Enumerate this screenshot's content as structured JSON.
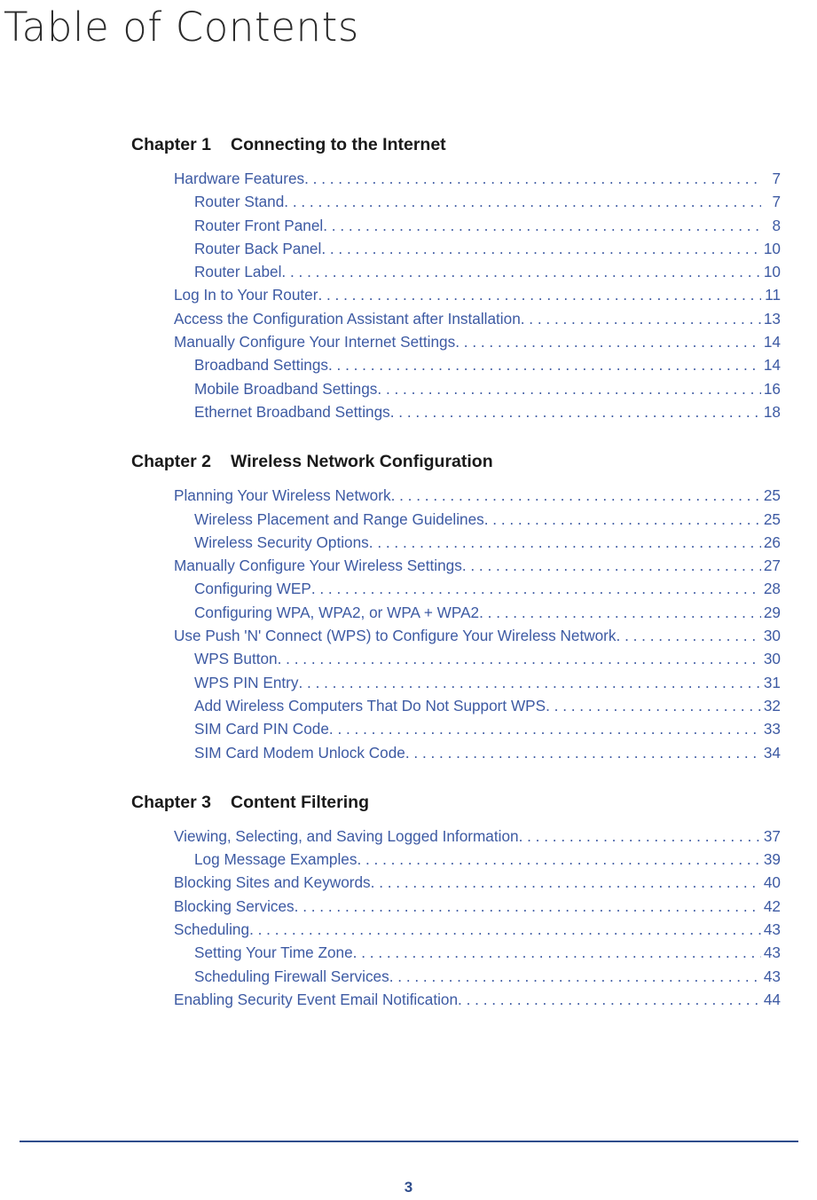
{
  "document": {
    "title": "Table of Contents",
    "page_number": "3",
    "accent_color": "#3d5aa3",
    "rule_color": "#2f4d8c",
    "title_color": "#2b2b2b",
    "heading_color": "#1a1a1a"
  },
  "chapters": [
    {
      "number": "Chapter 1",
      "name": "Connecting to the Internet",
      "entries": [
        {
          "level": 1,
          "title": "Hardware Features",
          "page": "7"
        },
        {
          "level": 2,
          "title": "Router Stand",
          "page": "7"
        },
        {
          "level": 2,
          "title": "Router Front Panel",
          "page": "8"
        },
        {
          "level": 2,
          "title": "Router Back Panel",
          "page": "10"
        },
        {
          "level": 2,
          "title": "Router Label",
          "page": "10"
        },
        {
          "level": 1,
          "title": "Log In to Your Router",
          "page": "11"
        },
        {
          "level": 1,
          "title": "Access the Configuration Assistant after Installation",
          "page": "13"
        },
        {
          "level": 1,
          "title": "Manually Configure Your Internet Settings",
          "page": "14"
        },
        {
          "level": 2,
          "title": "Broadband Settings",
          "page": "14"
        },
        {
          "level": 2,
          "title": "Mobile Broadband Settings",
          "page": "16"
        },
        {
          "level": 2,
          "title": "Ethernet Broadband Settings",
          "page": "18"
        }
      ]
    },
    {
      "number": "Chapter 2",
      "name": "Wireless Network Configuration",
      "entries": [
        {
          "level": 1,
          "title": "Planning Your Wireless Network",
          "page": "25"
        },
        {
          "level": 2,
          "title": "Wireless Placement and Range Guidelines",
          "page": "25"
        },
        {
          "level": 2,
          "title": "Wireless Security Options",
          "page": "26"
        },
        {
          "level": 1,
          "title": "Manually Configure Your Wireless Settings",
          "page": "27"
        },
        {
          "level": 2,
          "title": "Configuring WEP",
          "page": "28"
        },
        {
          "level": 2,
          "title": "Configuring WPA, WPA2, or WPA + WPA2",
          "page": "29"
        },
        {
          "level": 1,
          "title": "Use Push 'N' Connect (WPS) to Configure Your Wireless Network",
          "page": "30"
        },
        {
          "level": 2,
          "title": "WPS Button",
          "page": "30"
        },
        {
          "level": 2,
          "title": "WPS PIN Entry",
          "page": "31"
        },
        {
          "level": 2,
          "title": "Add Wireless Computers That Do Not Support WPS",
          "page": "32"
        },
        {
          "level": 2,
          "title": "SIM Card PIN Code",
          "page": "33"
        },
        {
          "level": 2,
          "title": "SIM Card Modem Unlock Code",
          "page": "34"
        }
      ]
    },
    {
      "number": "Chapter 3",
      "name": "Content Filtering",
      "entries": [
        {
          "level": 1,
          "title": "Viewing, Selecting, and Saving Logged Information",
          "page": "37"
        },
        {
          "level": 2,
          "title": "Log Message Examples",
          "page": "39"
        },
        {
          "level": 1,
          "title": "Blocking Sites and Keywords",
          "page": "40"
        },
        {
          "level": 1,
          "title": "Blocking Services",
          "page": "42"
        },
        {
          "level": 1,
          "title": "Scheduling",
          "page": "43"
        },
        {
          "level": 2,
          "title": "Setting Your Time Zone",
          "page": "43"
        },
        {
          "level": 2,
          "title": "Scheduling Firewall Services",
          "page": "43"
        },
        {
          "level": 1,
          "title": "Enabling Security Event Email Notification",
          "page": "44"
        }
      ]
    }
  ]
}
